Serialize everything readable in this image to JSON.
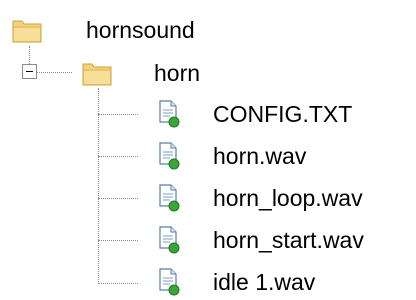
{
  "tree": {
    "root": {
      "label": "hornsound",
      "icon": "folder-icon"
    },
    "folder": {
      "label": "horn",
      "icon": "folder-icon",
      "expanded": true
    },
    "files": [
      {
        "label": "CONFIG.TXT",
        "icon": "file-icon"
      },
      {
        "label": "horn.wav",
        "icon": "file-icon"
      },
      {
        "label": "horn_loop.wav",
        "icon": "file-icon"
      },
      {
        "label": "horn_start.wav",
        "icon": "file-icon"
      },
      {
        "label": "idle 1.wav",
        "icon": "file-icon"
      }
    ],
    "colors": {
      "folder": "#f3d27a",
      "folder_dark": "#c9a53c",
      "file_badge": "#3aa63a",
      "line": "#8a8a8a"
    }
  }
}
